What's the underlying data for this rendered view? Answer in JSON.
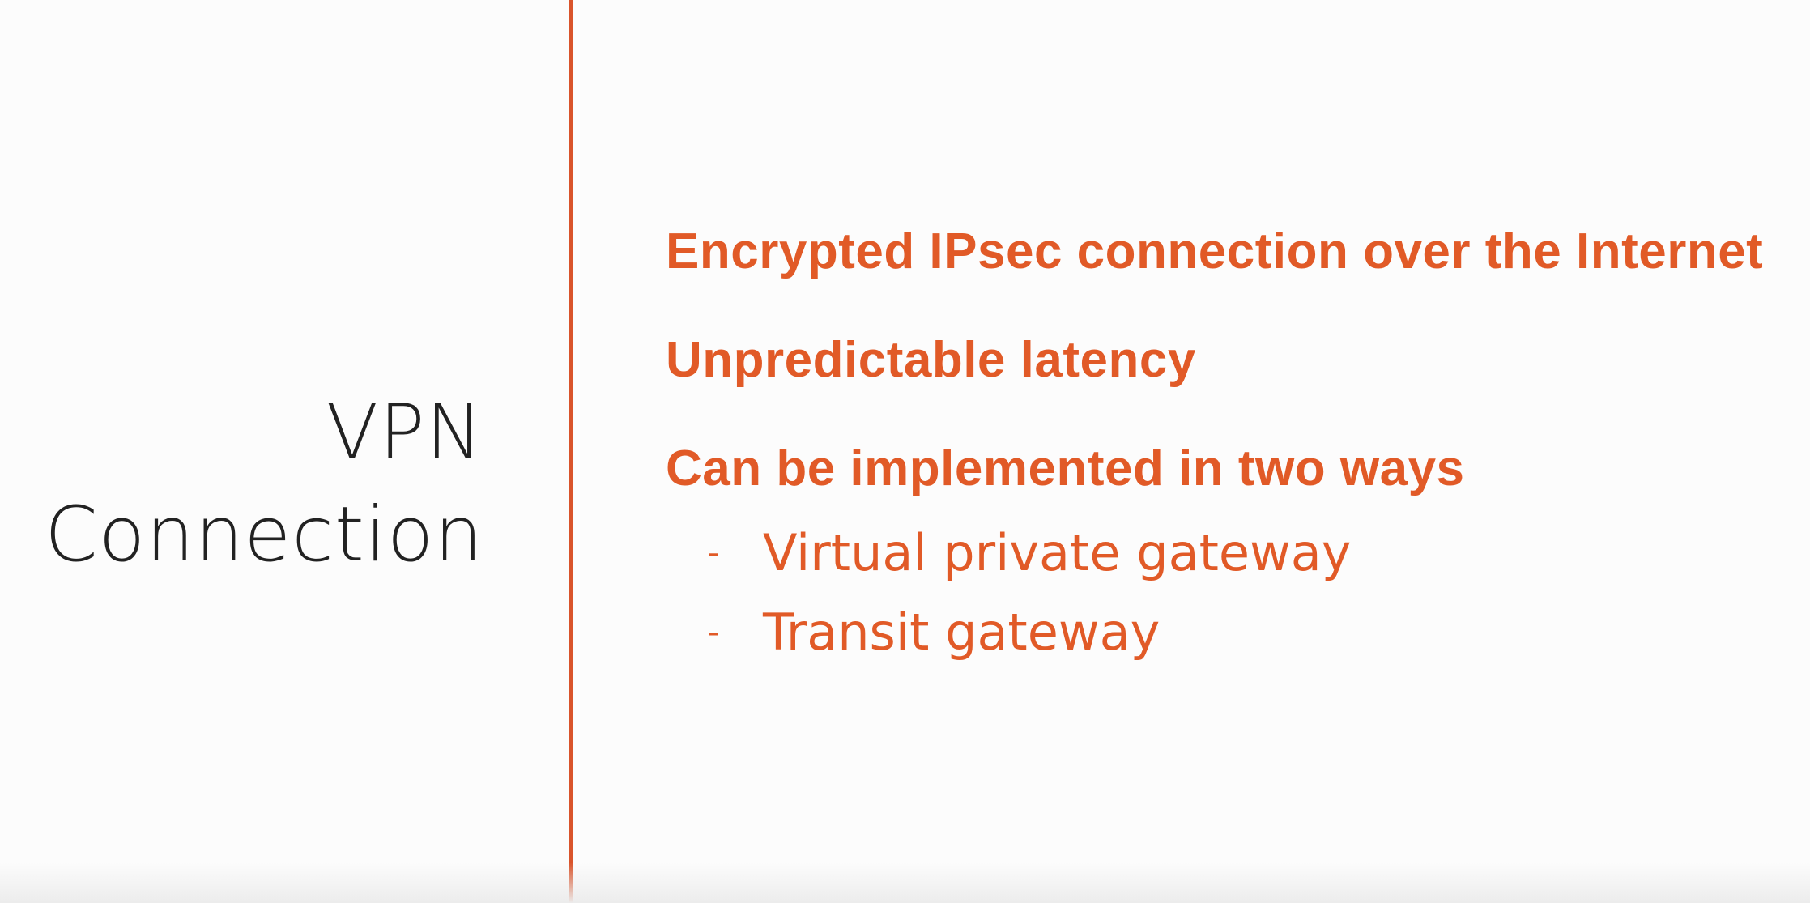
{
  "title": {
    "line1": "VPN",
    "line2": "Connection"
  },
  "points": [
    {
      "text": "Encrypted IPsec connection over the Internet"
    },
    {
      "text": "Unpredictable latency"
    },
    {
      "text": "Can be implemented in two ways"
    }
  ],
  "sub_points": [
    {
      "bullet": "-",
      "text": "Virtual private gateway"
    },
    {
      "bullet": "-",
      "text": "Transit gateway"
    }
  ],
  "colors": {
    "accent": "#e15a27",
    "divider": "#d9542b",
    "title_text": "#222222",
    "background": "#fcfcfc"
  }
}
